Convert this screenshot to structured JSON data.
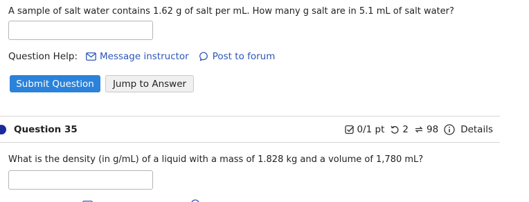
{
  "previous_question": {
    "text": "A sample of salt water contains 1.62 g of salt per mL. How many g salt are in 5.1 mL of salt water?",
    "answer_value": "",
    "help": {
      "label": "Question Help:",
      "message_link": "Message instructor",
      "forum_link": "Post to forum"
    },
    "buttons": {
      "submit": "Submit Question",
      "jump": "Jump to Answer"
    }
  },
  "question": {
    "title": "Question 35",
    "score": "0/1 pt",
    "retries": "2",
    "attempts": "98",
    "details_label": "Details",
    "text": "What is the density (in g/mL) of a liquid with a mass of 1.828 kg and a volume of 1,780 mL?",
    "answer_value": ""
  },
  "colors": {
    "accent": "#2a82da",
    "link": "#2c55b8",
    "indicator": "#1a2a9a"
  }
}
